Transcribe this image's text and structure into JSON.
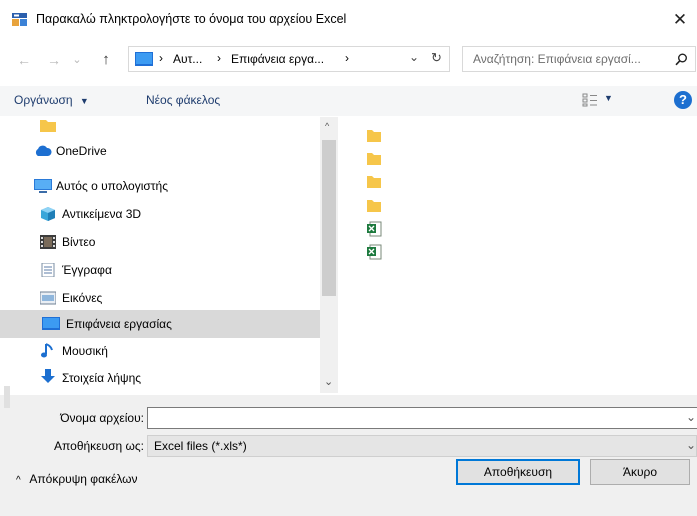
{
  "window": {
    "title": "Παρακαλώ πληκτρολογήστε το όνομα του αρχείου Excel",
    "close_glyph": "✕"
  },
  "nav": {
    "back_glyph": "←",
    "forward_glyph": "→",
    "dropdown_glyph": "⌄",
    "up_glyph": "↑",
    "refresh_glyph": "↻"
  },
  "address": {
    "sep1": "›",
    "crumb1": "Αυτ...",
    "sep2": "›",
    "crumb2": "Επιφάνεια εργα...",
    "sep3": "›"
  },
  "search": {
    "placeholder": "Αναζήτηση: Επιφάνεια εργασί..."
  },
  "toolbar": {
    "organize_label": "Οργάνωση",
    "new_folder_label": "Νέος φάκελος"
  },
  "sidebar": {
    "items": [
      {
        "label": ""
      },
      {
        "label": "OneDrive"
      },
      {
        "label": "Αυτός ο υπολογιστής"
      },
      {
        "label": "Αντικείμενα 3D"
      },
      {
        "label": "Βίντεο"
      },
      {
        "label": "Έγγραφα"
      },
      {
        "label": "Εικόνες"
      },
      {
        "label": "Επιφάνεια εργασίας"
      },
      {
        "label": "Μουσική"
      },
      {
        "label": "Στοιχεία λήψης"
      }
    ]
  },
  "form": {
    "filename_label": "Όνομα αρχείου:",
    "filename_value": "",
    "savetype_label": "Αποθήκευση ως:",
    "savetype_value": "Excel files (*.xls*)"
  },
  "footer": {
    "hide_folders_label": "Απόκρυψη φακέλων",
    "save_label": "Αποθήκευση",
    "cancel_label": "Άκυρο"
  },
  "colors": {
    "accent": "#0078d7",
    "link": "#1e3c6e",
    "folder": "#f6c64a",
    "excel": "#1d7a3e"
  }
}
